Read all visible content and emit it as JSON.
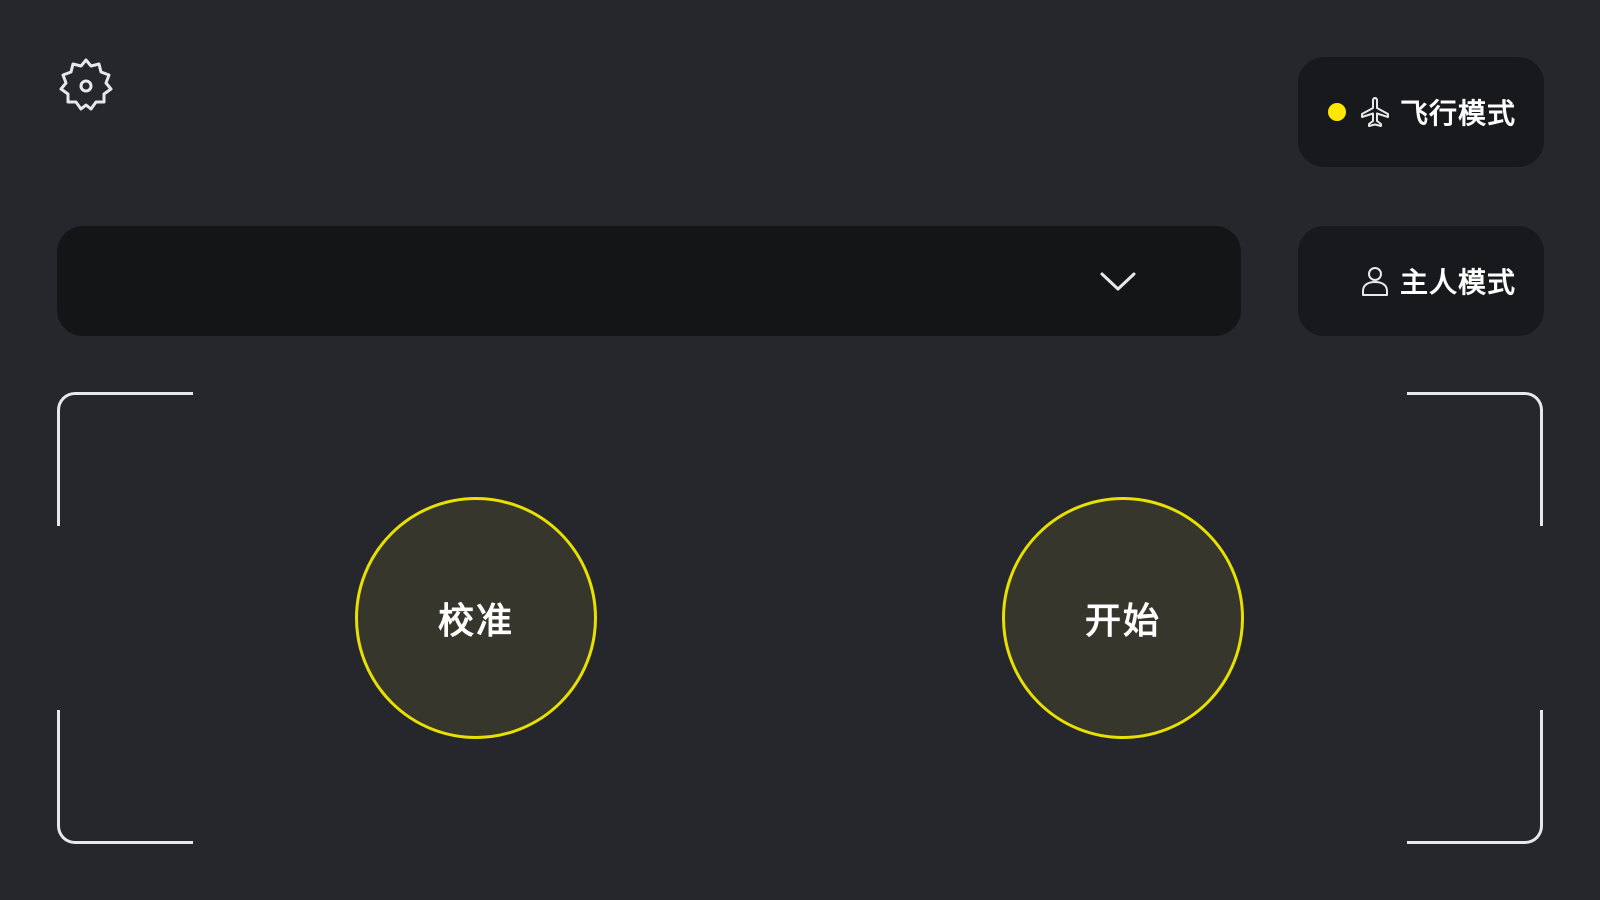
{
  "settings": {
    "icon": "gear-icon"
  },
  "flight_mode": {
    "label": "飞行模式",
    "icon": "airplane-icon",
    "status_color": "#ffe800"
  },
  "owner_mode": {
    "label": "主人模式",
    "icon": "person-icon"
  },
  "selector": {
    "value": "",
    "icon": "chevron-down-icon"
  },
  "actions": {
    "calibrate_label": "校准",
    "start_label": "开始"
  },
  "colors": {
    "background": "#26272d",
    "panel": "#18191c",
    "accent": "#e8e000",
    "button_fill": "#36362d"
  }
}
